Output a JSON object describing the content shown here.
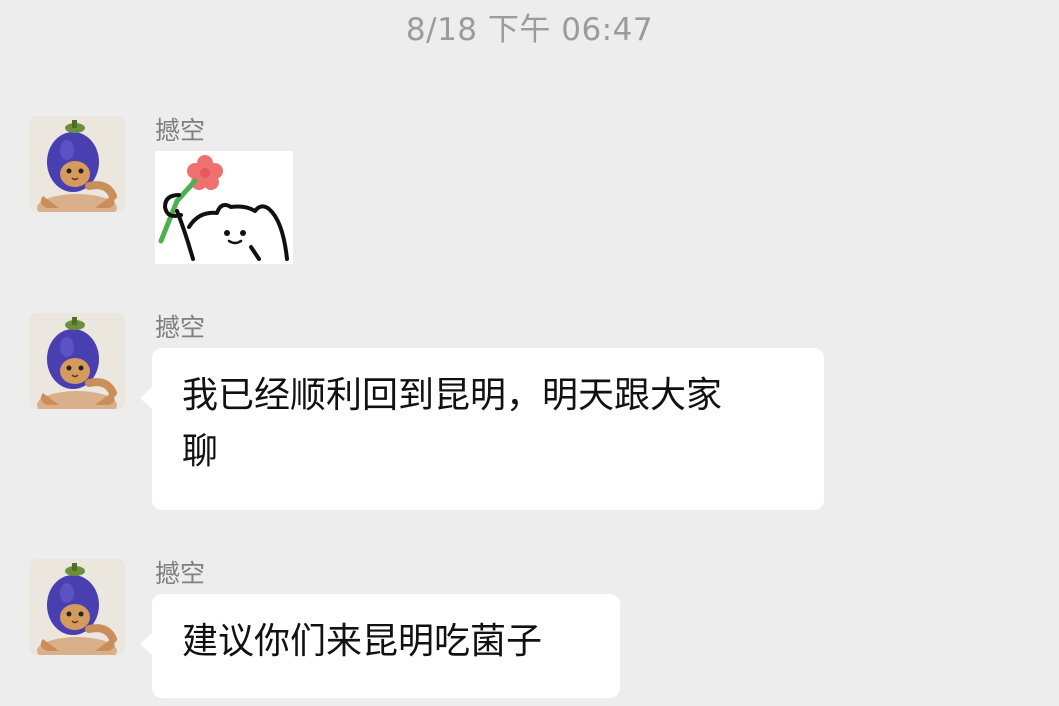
{
  "chat": {
    "timestamp": "8/18 下午 06:47",
    "messages": [
      {
        "sender": "撼空",
        "type": "sticker",
        "sticker_icon": "cat-holding-flower-sticker"
      },
      {
        "sender": "撼空",
        "type": "text",
        "lines": [
          "我已经顺利回到昆明，明天跟大家",
          "聊"
        ]
      },
      {
        "sender": "撼空",
        "type": "text",
        "lines": [
          "建议你们来昆明吃菌子"
        ]
      }
    ]
  },
  "colors": {
    "background": "#ededed",
    "bubble": "#ffffff",
    "timestamp_text": "#9b9b9b",
    "sender_text": "#7f7f7f",
    "message_text": "#111111",
    "avatar_hat": "#4a3fb0"
  }
}
